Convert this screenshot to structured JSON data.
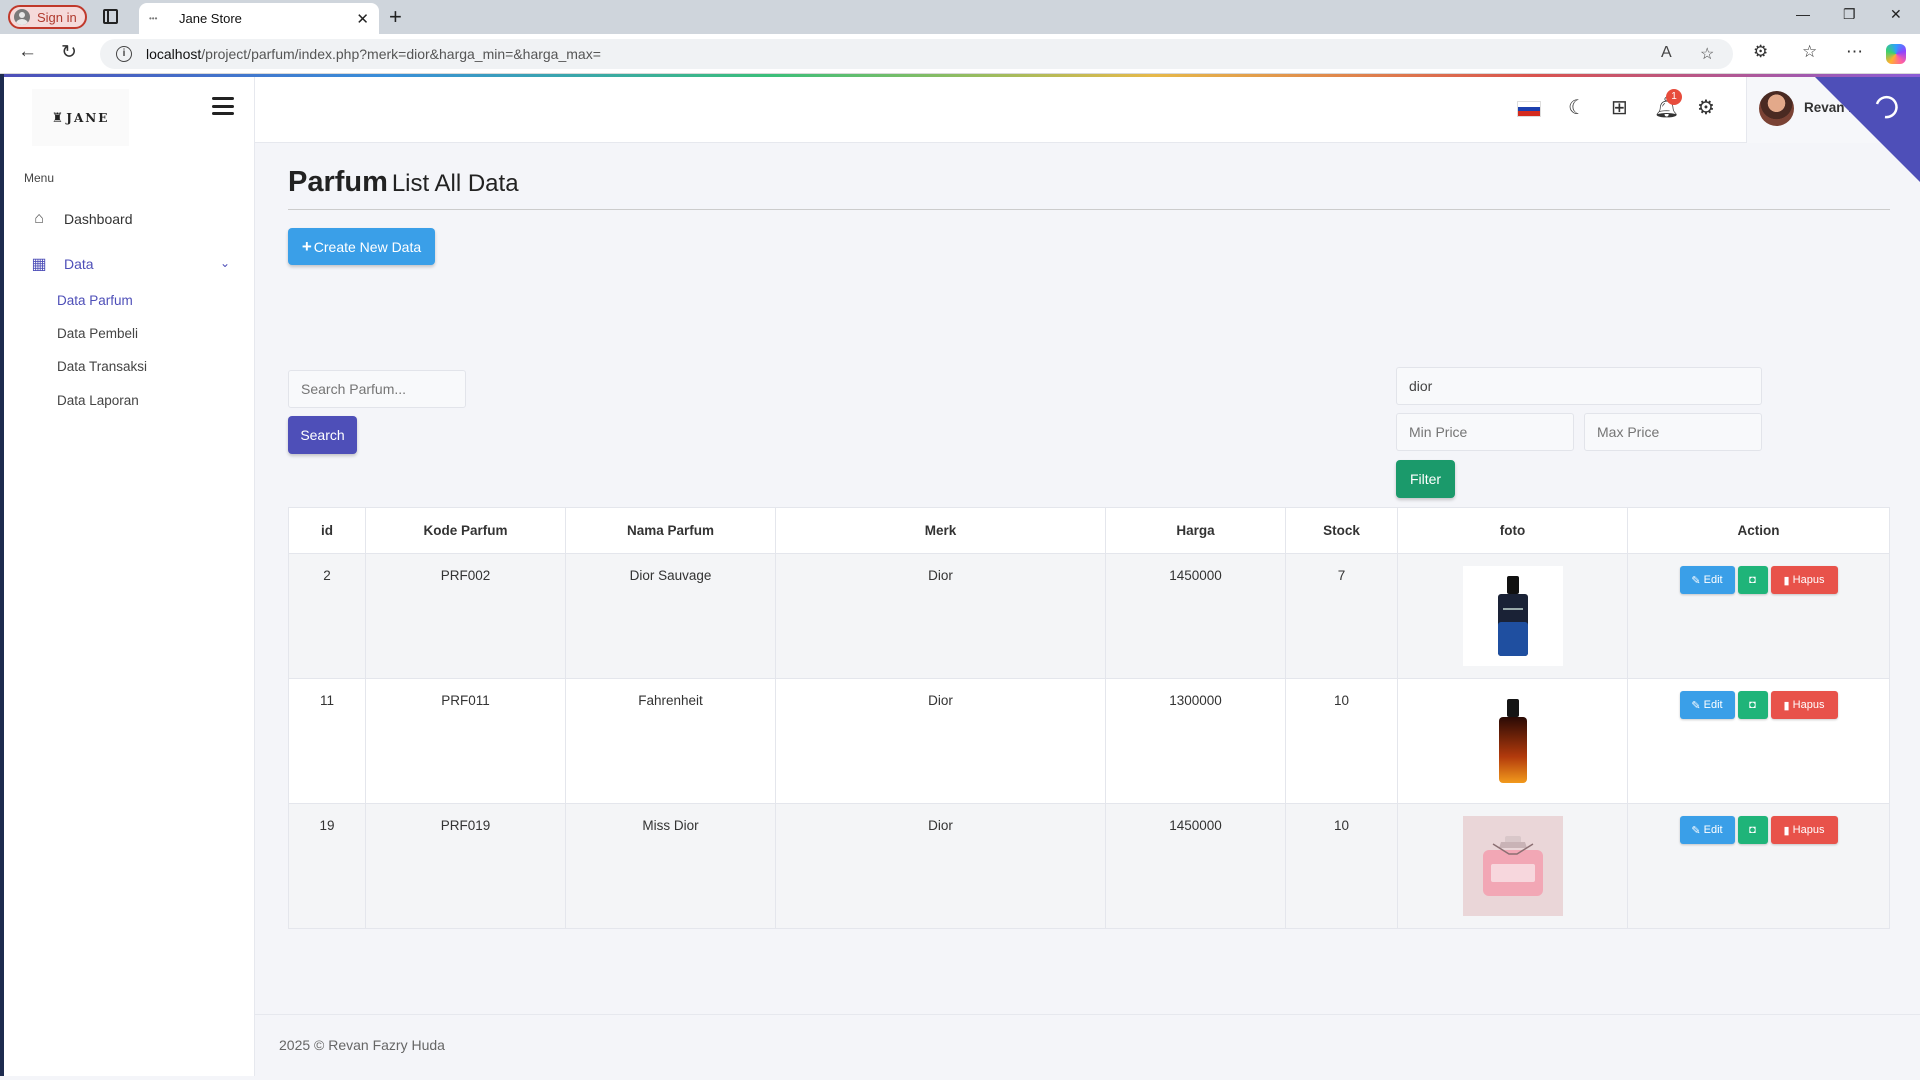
{
  "browser": {
    "signin_label": "Sign in",
    "tab_title": "Jane Store",
    "url_host": "localhost",
    "url_path": "/project/parfum/index.php?merk=dior&harga_min=&harga_max="
  },
  "sidebar": {
    "logo_text": "JANE",
    "menu_label": "Menu",
    "items": [
      {
        "label": "Dashboard",
        "icon": "home-icon"
      },
      {
        "label": "Data",
        "icon": "layout-icon"
      }
    ],
    "sub_items": [
      {
        "label": "Data Parfum"
      },
      {
        "label": "Data Pembeli"
      },
      {
        "label": "Data Transaksi"
      },
      {
        "label": "Data Laporan"
      }
    ]
  },
  "topbar": {
    "notification_count": "1",
    "user_name": "Revan F"
  },
  "main": {
    "title_main": "Parfum",
    "title_sub": "List All Data",
    "create_label": "Create New Data",
    "search_placeholder": "Search Parfum...",
    "search_label": "Search",
    "filter_merk_value": "dior",
    "min_price_placeholder": "Min Price",
    "max_price_placeholder": "Max Price",
    "filter_label": "Filter"
  },
  "table": {
    "headers": [
      "id",
      "Kode Parfum",
      "Nama Parfum",
      "Merk",
      "Harga",
      "Stock",
      "foto",
      "Action"
    ],
    "rows": [
      {
        "id": "2",
        "kode": "PRF002",
        "nama": "Dior Sauvage",
        "merk": "Dior",
        "harga": "1450000",
        "stock": "7"
      },
      {
        "id": "11",
        "kode": "PRF011",
        "nama": "Fahrenheit",
        "merk": "Dior",
        "harga": "1300000",
        "stock": "10"
      },
      {
        "id": "19",
        "kode": "PRF019",
        "nama": "Miss Dior",
        "merk": "Dior",
        "harga": "1450000",
        "stock": "10"
      }
    ],
    "edit_label": "Edit",
    "delete_label": "Hapus"
  },
  "footer": {
    "text": "2025 © Revan Fazry Huda"
  },
  "colors": {
    "primary": "#4e4fb8",
    "info": "#3a9fe8",
    "success": "#1b9a6b",
    "danger": "#e8524a"
  }
}
